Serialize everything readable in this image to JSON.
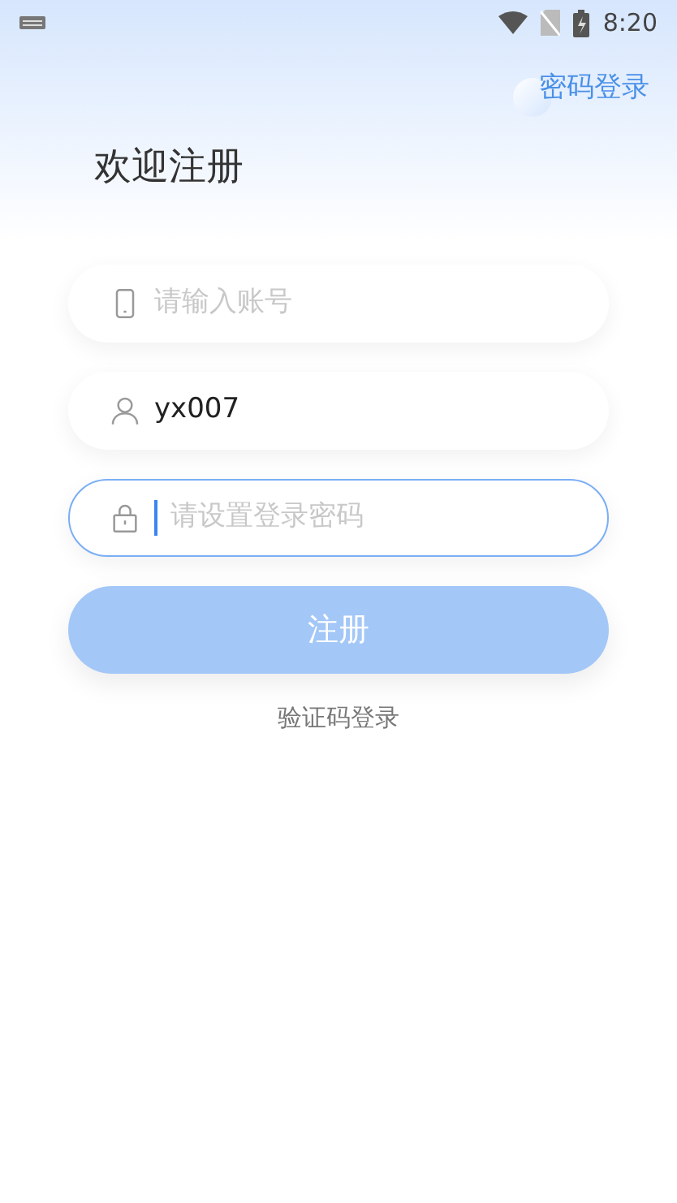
{
  "status_bar": {
    "time": "8:20"
  },
  "top_link": "密码登录",
  "title": "欢迎注册",
  "fields": [
    {
      "kind": "phone",
      "placeholder": "请输入账号",
      "focused": false
    },
    {
      "kind": "user",
      "value": "yx007",
      "focused": false
    },
    {
      "kind": "lock",
      "placeholder": "请设置登录密码",
      "focused": true
    }
  ],
  "submit": {
    "label": "注册",
    "disabled": true
  },
  "alt_link": "验证码登录"
}
